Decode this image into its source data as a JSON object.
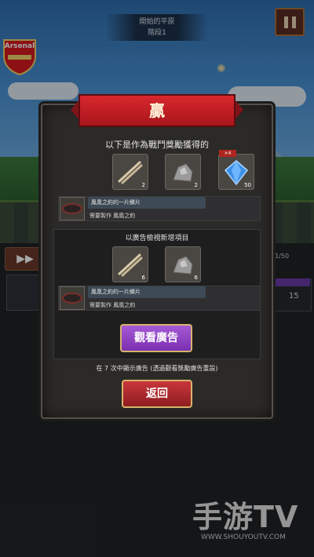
{
  "hud": {
    "stage_name": "開始的平原",
    "stage_level": "階段1",
    "badge_text": "Arsenal"
  },
  "background": {
    "left_progress_glyph": "▶▶",
    "right_count": "41/50",
    "right_number": "15"
  },
  "dialog": {
    "banner": "贏",
    "reward_title": "以下是作為戰鬥獎勵獲得的",
    "rewards": [
      {
        "icon": "bone-sticks-icon",
        "qty": "2"
      },
      {
        "icon": "ore-rock-icon",
        "qty": "2"
      },
      {
        "icon": "blue-gem-icon",
        "qty": "50",
        "tag": "×4"
      }
    ],
    "reward_item": {
      "name": "鳳凰之約的一片鱗片",
      "need": "需要製作 鳳凰之約"
    },
    "ad_section": {
      "title": "以廣告檢視新增項目",
      "rewards": [
        {
          "icon": "bone-sticks-icon",
          "qty": "6"
        },
        {
          "icon": "ore-rock-icon",
          "qty": "6"
        }
      ],
      "item": {
        "name": "鳳凰之約的一片鱗片",
        "need": "需要製作 鳳凰之約"
      },
      "watch_button": "觀看廣告"
    },
    "ad_note": "在 7 次中顯示廣告 (透過觀看獎勵廣告重設)",
    "back_button": "返回"
  },
  "watermark": {
    "brand": "手游TV",
    "url": "WWW.SHOUYOUTV.COM"
  },
  "colors": {
    "banner_red": "#c8202a",
    "watch_purple": "#8f42c4",
    "back_red": "#a82a2f",
    "gold_border": "#d6b46a"
  }
}
